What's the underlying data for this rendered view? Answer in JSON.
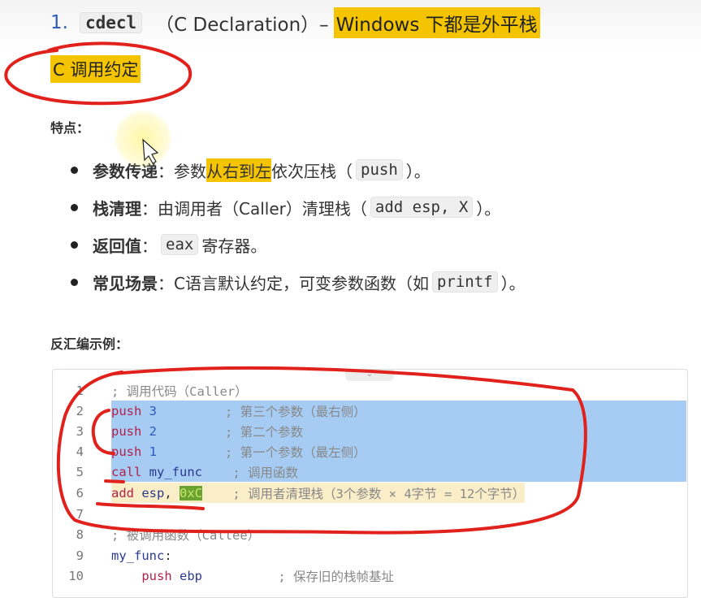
{
  "heading": {
    "number": "1.",
    "code": "cdecl",
    "paren": "（C Declaration）–",
    "highlight": "Windows 下都是外平栈"
  },
  "subtitle": "C 调用约定",
  "features_label": "特点：",
  "bullets": [
    {
      "bold": "参数传递",
      "pre": "：参数",
      "hl": "从右到左",
      "post": "依次压栈（",
      "code": "push",
      "end": "）。"
    },
    {
      "bold": "栈清理",
      "pre": "：由调用者（Caller）清理栈（",
      "code": "add esp, X",
      "end": "）。"
    },
    {
      "bold": "返回值",
      "pre": "：",
      "code": "eax",
      "end": "寄存器。"
    },
    {
      "bold": "常见场景",
      "pre": "：C语言默认约定，可变参数函数（如",
      "code": "printf",
      "end": "）。"
    }
  ],
  "disasm_label": "反汇编示例：",
  "code_lines": [
    {
      "n": "1",
      "parts": [
        {
          "t": "; 调用代码（Caller）",
          "c": "cm"
        }
      ]
    },
    {
      "n": "2",
      "parts": [
        {
          "t": "push ",
          "c": "kw"
        },
        {
          "t": "3",
          "c": "num"
        },
        {
          "t": "         ; 第三个参数（最右侧）",
          "c": "cm"
        }
      ]
    },
    {
      "n": "3",
      "parts": [
        {
          "t": "push ",
          "c": "kw"
        },
        {
          "t": "2",
          "c": "num"
        },
        {
          "t": "         ; 第二个参数",
          "c": "cm"
        }
      ]
    },
    {
      "n": "4",
      "parts": [
        {
          "t": "push ",
          "c": "kw"
        },
        {
          "t": "1",
          "c": "num"
        },
        {
          "t": "         ; 第一个参数（最左侧）",
          "c": "cm"
        }
      ]
    },
    {
      "n": "5",
      "parts": [
        {
          "t": "call ",
          "c": "kw"
        },
        {
          "t": "my_func",
          "c": "fn"
        },
        {
          "t": "    ; 调用函数",
          "c": "cm"
        }
      ]
    },
    {
      "n": "6",
      "parts": [
        {
          "t": "add ",
          "c": "kw"
        },
        {
          "t": "esp",
          "c": "fn"
        },
        {
          "t": ", ",
          "c": ""
        },
        {
          "t": "0xC",
          "c": "hex"
        },
        {
          "t": "    ; 调用者清理栈（3个参数 × 4字节 = 12个字节）",
          "c": "cm"
        }
      ]
    },
    {
      "n": "7",
      "parts": []
    },
    {
      "n": "8",
      "parts": [
        {
          "t": "; 被调用函数（Callee）",
          "c": "cm"
        }
      ]
    },
    {
      "n": "9",
      "parts": [
        {
          "t": "my_func",
          "c": "fn"
        },
        {
          "t": ":",
          "c": ""
        }
      ]
    },
    {
      "n": "10",
      "parts": [
        {
          "t": "    push ",
          "c": "kw"
        },
        {
          "t": "ebp",
          "c": "fn"
        },
        {
          "t": "          ; 保存旧的栈帧基址",
          "c": "cm"
        }
      ]
    }
  ],
  "colors": {
    "highlight": "#f5c400",
    "selection": "#a7ccf4",
    "annotation": "#e0211c"
  }
}
